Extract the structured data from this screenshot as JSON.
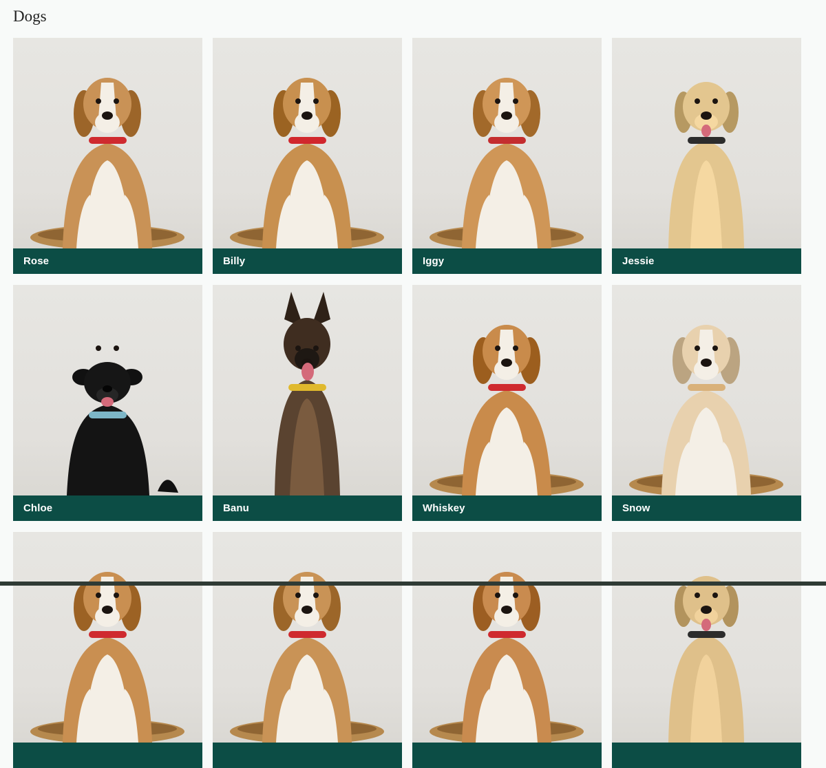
{
  "page": {
    "title": "Dogs"
  },
  "dogs": [
    {
      "name": "Rose",
      "breed": "beagle",
      "collar": "#cf2a2f",
      "coat": "#c99256"
    },
    {
      "name": "Billy",
      "breed": "beagle",
      "collar": "#d1272d",
      "coat": "#c8904f"
    },
    {
      "name": "Iggy",
      "breed": "beagle",
      "collar": "#c42d2f",
      "coat": "#cf9657"
    },
    {
      "name": "Jessie",
      "breed": "labrador",
      "collar": "#2c2c2c",
      "coat": "#e3c68f"
    },
    {
      "name": "Chloe",
      "breed": "black-mix",
      "collar": "#7db6c7",
      "coat": "#181818"
    },
    {
      "name": "Banu",
      "breed": "shepherd",
      "collar": "#e0b92d",
      "coat": "#5a4330"
    },
    {
      "name": "Whiskey",
      "breed": "beagle",
      "collar": "#cf2a2f",
      "coat": "#c98b4b"
    },
    {
      "name": "Snow",
      "breed": "beagle",
      "collar": "#d9b17a",
      "coat": "#e8d1ae"
    },
    {
      "name": "",
      "breed": "beagle",
      "collar": "#cf2a2f",
      "coat": "#c98f51"
    },
    {
      "name": "",
      "breed": "beagle",
      "collar": "#cf2a2f",
      "coat": "#c99356"
    },
    {
      "name": "",
      "breed": "beagle",
      "collar": "#cf2a2f",
      "coat": "#c98b4f"
    },
    {
      "name": "",
      "breed": "labrador",
      "collar": "#2c2c2c",
      "coat": "#dfc08a"
    }
  ],
  "colors": {
    "label_background": "#0c4d45",
    "page_background": "#f8faf9",
    "photo_background": "#e7e6e2"
  }
}
